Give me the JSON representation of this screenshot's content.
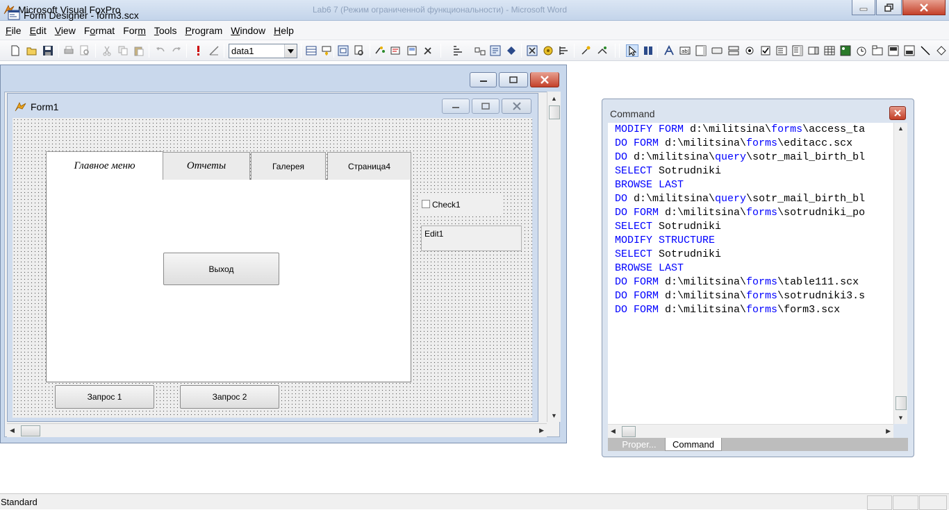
{
  "app": {
    "title": "Microsoft Visual FoxPro",
    "background_window_title": "Lab6 7 (Режим ограниченной функциональности) - Microsoft Word"
  },
  "menu": {
    "items": [
      {
        "label": "File",
        "hotkey": "F"
      },
      {
        "label": "Edit",
        "hotkey": "E"
      },
      {
        "label": "View",
        "hotkey": "V"
      },
      {
        "label": "Format",
        "hotkey": "o"
      },
      {
        "label": "Form",
        "hotkey": "m"
      },
      {
        "label": "Tools",
        "hotkey": "T"
      },
      {
        "label": "Program",
        "hotkey": "P"
      },
      {
        "label": "Window",
        "hotkey": "W"
      },
      {
        "label": "Help",
        "hotkey": "H"
      }
    ]
  },
  "toolbar": {
    "database_combo_value": "data1",
    "icons": [
      "new-file-icon",
      "open-folder-icon",
      "save-icon",
      "print-icon",
      "print-preview-icon",
      "cut-icon",
      "copy-icon",
      "paste-icon",
      "undo-icon",
      "redo-icon",
      "run-icon",
      "modify-icon",
      "data-session-icon",
      "properties-window-icon",
      "code-window-icon",
      "form-control-toolbar-icon",
      "color-palette-icon",
      "layout-toolbar-icon",
      "form-builder-icon",
      "autoformat-icon",
      "command-window-icon",
      "database-designer-icon",
      "tab-order-icon",
      "connections-icon",
      "builder-lock-icon",
      "toolbox-icon",
      "wizards-icon",
      "select-objects-icon",
      "view-classes-icon",
      "label-icon",
      "textbox-icon",
      "editbox-icon",
      "command-button-icon",
      "command-group-icon",
      "option-group-icon",
      "checkbox-icon",
      "combobox-icon",
      "listbox-icon",
      "spinner-icon",
      "grid-icon",
      "image-icon",
      "timer-icon",
      "pageframe-icon",
      "oleobject-icon",
      "line-icon",
      "shape-icon"
    ]
  },
  "form_designer": {
    "title": "Form Designer - form3.scx",
    "form_title": "Form1",
    "tabs": [
      {
        "label": "Главное меню",
        "active": true
      },
      {
        "label": "Отчеты",
        "active": false
      },
      {
        "label": "Галерея",
        "active": false
      },
      {
        "label": "Страница4",
        "active": false
      }
    ],
    "exit_button_label": "Выход",
    "query1_button_label": "Запрос 1",
    "query2_button_label": "Запрос 2",
    "checkbox_label": "Check1",
    "editbox_label": "Edit1"
  },
  "command_window": {
    "title": "Command",
    "lines": [
      [
        {
          "t": "MODIFY FORM",
          "k": true
        },
        {
          "t": " d:\\militsina\\",
          "k": false
        },
        {
          "t": "forms",
          "k": true
        },
        {
          "t": "\\access_ta",
          "k": false
        }
      ],
      [
        {
          "t": "DO FORM",
          "k": true
        },
        {
          "t": " d:\\militsina\\",
          "k": false
        },
        {
          "t": "forms",
          "k": true
        },
        {
          "t": "\\editacc.scx",
          "k": false
        }
      ],
      [
        {
          "t": "DO",
          "k": true
        },
        {
          "t": " d:\\militsina\\",
          "k": false
        },
        {
          "t": "query",
          "k": true
        },
        {
          "t": "\\sotr_mail_birth_bl",
          "k": false
        }
      ],
      [
        {
          "t": "SELECT",
          "k": true
        },
        {
          "t": " Sotrudniki",
          "k": false
        }
      ],
      [
        {
          "t": "BROWSE LAST",
          "k": true
        }
      ],
      [
        {
          "t": "DO",
          "k": true
        },
        {
          "t": " d:\\militsina\\",
          "k": false
        },
        {
          "t": "query",
          "k": true
        },
        {
          "t": "\\sotr_mail_birth_bl",
          "k": false
        }
      ],
      [
        {
          "t": "DO FORM",
          "k": true
        },
        {
          "t": " d:\\militsina\\",
          "k": false
        },
        {
          "t": "forms",
          "k": true
        },
        {
          "t": "\\sotrudniki_po",
          "k": false
        }
      ],
      [
        {
          "t": "SELECT",
          "k": true
        },
        {
          "t": " Sotrudniki",
          "k": false
        }
      ],
      [
        {
          "t": "MODIFY STRUCTURE",
          "k": true
        }
      ],
      [
        {
          "t": "SELECT",
          "k": true
        },
        {
          "t": " Sotrudniki",
          "k": false
        }
      ],
      [
        {
          "t": "BROWSE LAST",
          "k": true
        }
      ],
      [
        {
          "t": "DO FORM",
          "k": true
        },
        {
          "t": " d:\\militsina\\",
          "k": false
        },
        {
          "t": "forms",
          "k": true
        },
        {
          "t": "\\table111.scx",
          "k": false
        }
      ],
      [
        {
          "t": "DO FORM",
          "k": true
        },
        {
          "t": " d:\\militsina\\",
          "k": false
        },
        {
          "t": "forms",
          "k": true
        },
        {
          "t": "\\sotrudniki3.s",
          "k": false
        }
      ],
      [
        {
          "t": "DO FORM",
          "k": true
        },
        {
          "t": " d:\\militsina\\",
          "k": false
        },
        {
          "t": "forms",
          "k": true
        },
        {
          "t": "\\form3.scx",
          "k": false
        }
      ]
    ],
    "tabs": [
      {
        "label": "Proper...",
        "active": false
      },
      {
        "label": "Command",
        "active": true
      }
    ]
  },
  "statusbar": {
    "text": "Standard"
  },
  "colors": {
    "keyword": "#0000ff",
    "titlebar": "#c3d4ea",
    "close_button": "#c4412a"
  }
}
